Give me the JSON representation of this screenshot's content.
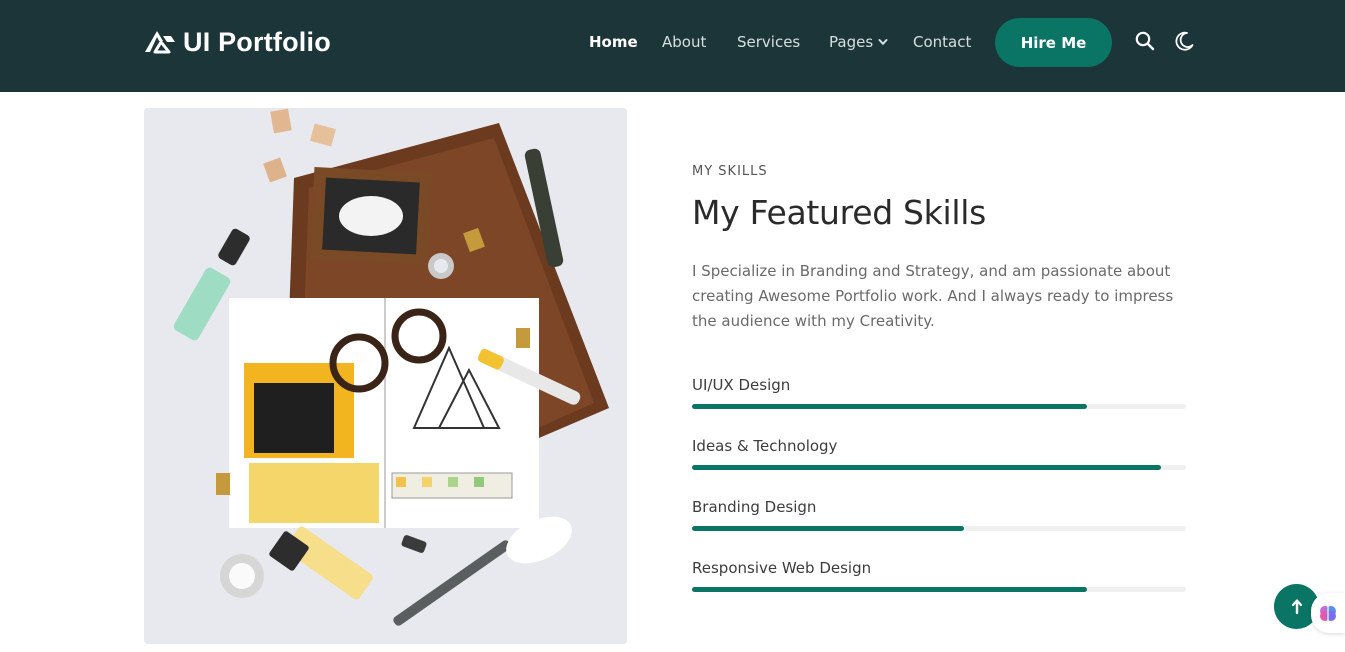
{
  "brand": {
    "name": "UI Portfolio",
    "logo_icon": "logo-mark-icon"
  },
  "nav": {
    "items": [
      {
        "label": "Home",
        "active": true
      },
      {
        "label": "About"
      },
      {
        "label": "Services"
      },
      {
        "label": "Pages",
        "has_dropdown": true
      },
      {
        "label": "Contact"
      }
    ],
    "cta_label": "Hire Me",
    "search_icon": "search-icon",
    "theme_icon": "moon-icon"
  },
  "skills": {
    "kicker": "MY SKILLS",
    "title": "My Featured Skills",
    "description": "I Specialize in Branding and Strategy, and am passionate about creating Awesome Portfolio work. And I always ready to impress the audience with my Creativity.",
    "items": [
      {
        "label": "UI/UX Design",
        "percent": 80
      },
      {
        "label": "Ideas & Technology",
        "percent": 95
      },
      {
        "label": "Branding Design",
        "percent": 55
      },
      {
        "label": "Responsive Web Design",
        "percent": 80
      }
    ]
  },
  "colors": {
    "header_bg": "#1c3539",
    "accent": "#0a7465",
    "track": "#f0f0f0"
  },
  "floating": {
    "scroll_top_icon": "arrow-up-icon",
    "widget_icon": "brain-icon"
  }
}
